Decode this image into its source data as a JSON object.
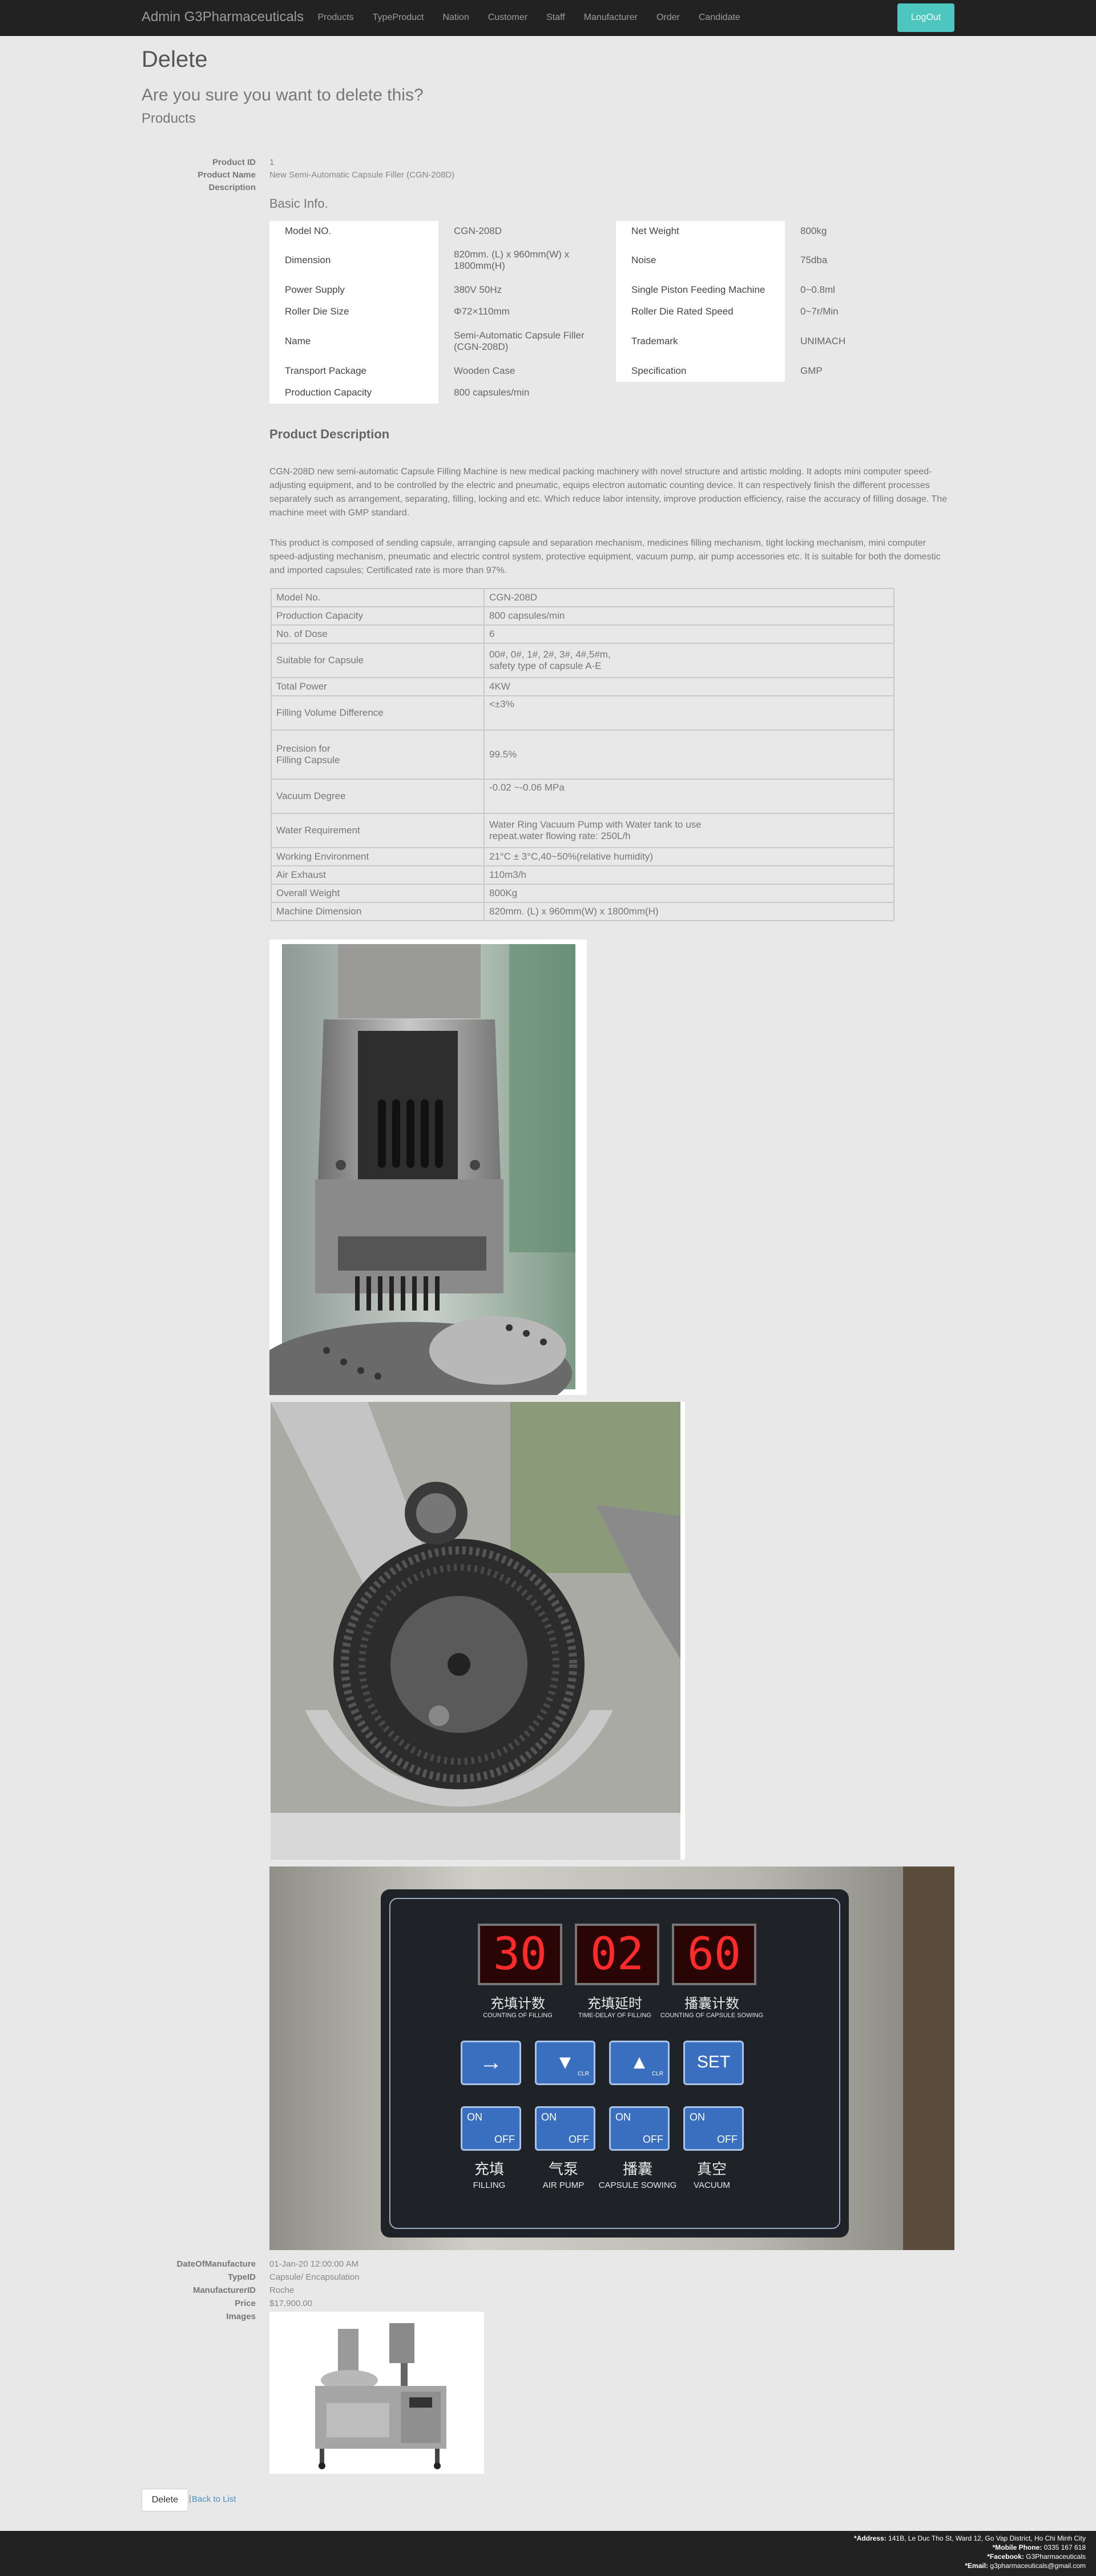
{
  "nav": {
    "brand": "Admin G3Pharmaceuticals",
    "links": [
      "Products",
      "TypeProduct",
      "Nation",
      "Customer",
      "Staff",
      "Manufacturer",
      "Order",
      "Candidate"
    ],
    "logout": "LogOut"
  },
  "page": {
    "title": "Delete",
    "confirm": "Are you sure you want to delete this?",
    "entity": "Products"
  },
  "fields": {
    "product_id_label": "Product ID",
    "product_id": "1",
    "product_name_label": "Product Name",
    "product_name": "New Semi-Automatic Capsule Filler (CGN-208D)",
    "description_label": "Description",
    "date_label": "DateOfManufacture",
    "date": "01-Jan-20 12:00:00 AM",
    "type_label": "TypeID",
    "type": "Capsule/ Encapsulation",
    "manufacturer_label": "ManufacturerID",
    "manufacturer": "Roche",
    "price_label": "Price",
    "price": "$17,900.00",
    "images_label": "Images"
  },
  "description": {
    "basic_title": "Basic Info.",
    "basic_rows": [
      {
        "k1": "Model NO.",
        "v1": "CGN-208D",
        "k2": "Net Weight",
        "v2": "800kg"
      },
      {
        "k1": "Dimension",
        "v1": "820mm. (L) x 960mm(W) x 1800mm(H)",
        "k2": "Noise",
        "v2": "75dba"
      },
      {
        "k1": "Power Supply",
        "v1": "380V 50Hz",
        "k2": "Single Piston Feeding Machine",
        "v2": "0~0.8ml"
      },
      {
        "k1": "Roller Die Size",
        "v1": "Φ72×110mm",
        "k2": "Roller Die Rated Speed",
        "v2": "0~7r/Min"
      },
      {
        "k1": "Name",
        "v1": "Semi-Automatic Capsule Filler (CGN-208D)",
        "k2": "Trademark",
        "v2": "UNIMACH"
      },
      {
        "k1": "Transport Package",
        "v1": "Wooden Case",
        "k2": "Specification",
        "v2": "GMP"
      },
      {
        "k1": "Production Capacity",
        "v1": "800 capsules/min",
        "k2": "",
        "v2": ""
      }
    ],
    "pd_title": "Product Description",
    "para1": "CGN-208D new semi-automatic Capsule Filling Machine is new medical packing machinery with novel structure and artistic molding. It adopts mini computer speed-adjusting equipment, and to be controlled by the electric and pneumatic, equips electron automatic counting device. It can respectively finish the different processes separately such as arrangement, separating, filling, locking and etc. Which reduce labor intensity, improve production efficiency, raise the accuracy of filling dosage. The machine meet with GMP standard.",
    "para2": "This product is composed of sending capsule, arranging capsule and separation mechanism, medicines filling mechanism, tight locking mechanism, mini computer speed-adjusting mechanism, pneumatic and electric control system, protective equipment, vacuum pump, air pump accessories etc. It is suitable for both the domestic and imported capsules; Certificated rate is more than 97%.",
    "spec_rows": [
      {
        "k": "Model No.",
        "v": "CGN-208D"
      },
      {
        "k": "Production Capacity",
        "v": "800 capsules/min"
      },
      {
        "k": "No. of Dose",
        "v": "6"
      },
      {
        "k": "Suitable for Capsule",
        "v": "00#, 0#, 1#, 2#, 3#, 4#,5#m, safety type of capsule A-E"
      },
      {
        "k": "Total Power",
        "v": "4KW"
      },
      {
        "k": "Filling Volume Difference",
        "v": "<±3%"
      },
      {
        "k": "Precision for Filling Capsule",
        "v": "99.5%"
      },
      {
        "k": "Vacuum Degree",
        "v": "-0.02 ~-0.06 MPa"
      },
      {
        "k": "Water Requirement",
        "v": "Water Ring Vacuum Pump with Water tank to use repeat.water flowing rate: 250L/h"
      },
      {
        "k": "Working Environment",
        "v": "21°C ± 3°C,40~50%(relative humidity)"
      },
      {
        "k": "Air Exhaust",
        "v": "110m3/h"
      },
      {
        "k": "Overall Weight",
        "v": "800Kg"
      },
      {
        "k": "Machine Dimension",
        "v": "820mm. (L) x 960mm(W) x 1800mm(H)"
      }
    ]
  },
  "panel": {
    "displays": [
      "30",
      "02",
      "60"
    ],
    "display_cn": [
      "充填计数",
      "充填延时",
      "播囊计数"
    ],
    "display_en": [
      "COUNTING OF FILLING",
      "TIME-DELAY OF FILLING",
      "COUNTING OF CAPSULE SOWING"
    ],
    "keys": [
      "→",
      "▼",
      "▲",
      "SET"
    ],
    "toggle_on": "ON",
    "toggle_off": "OFF",
    "toggle_cn": [
      "充填",
      "气泵",
      "播囊",
      "真空"
    ],
    "toggle_en": [
      "FILLING",
      "AIR PUMP",
      "CAPSULE SOWING",
      "VACUUM"
    ],
    "clr": "CLR"
  },
  "actions": {
    "delete": "Delete",
    "separator": "|",
    "back": "Back to List"
  },
  "footer": {
    "address_label": "*Address:",
    "address": "141B, Le Duc Tho St, Ward 12, Go Vap District, Ho Chi Minh City",
    "phone_label": "*Mobile Phone:",
    "phone": "0335 167 618",
    "facebook_label": "*Facebook:",
    "facebook": "G3Pharmaceuticals",
    "email_label": "*Email:",
    "email": "g3pharmaceuticals@gmail.com"
  },
  "colors": {
    "navbar": "#222222",
    "logout_button": "#4ec6c0",
    "page_background": "#e8e8e8",
    "led": "#ff2a2a",
    "key_blue": "#3a6fc0"
  }
}
